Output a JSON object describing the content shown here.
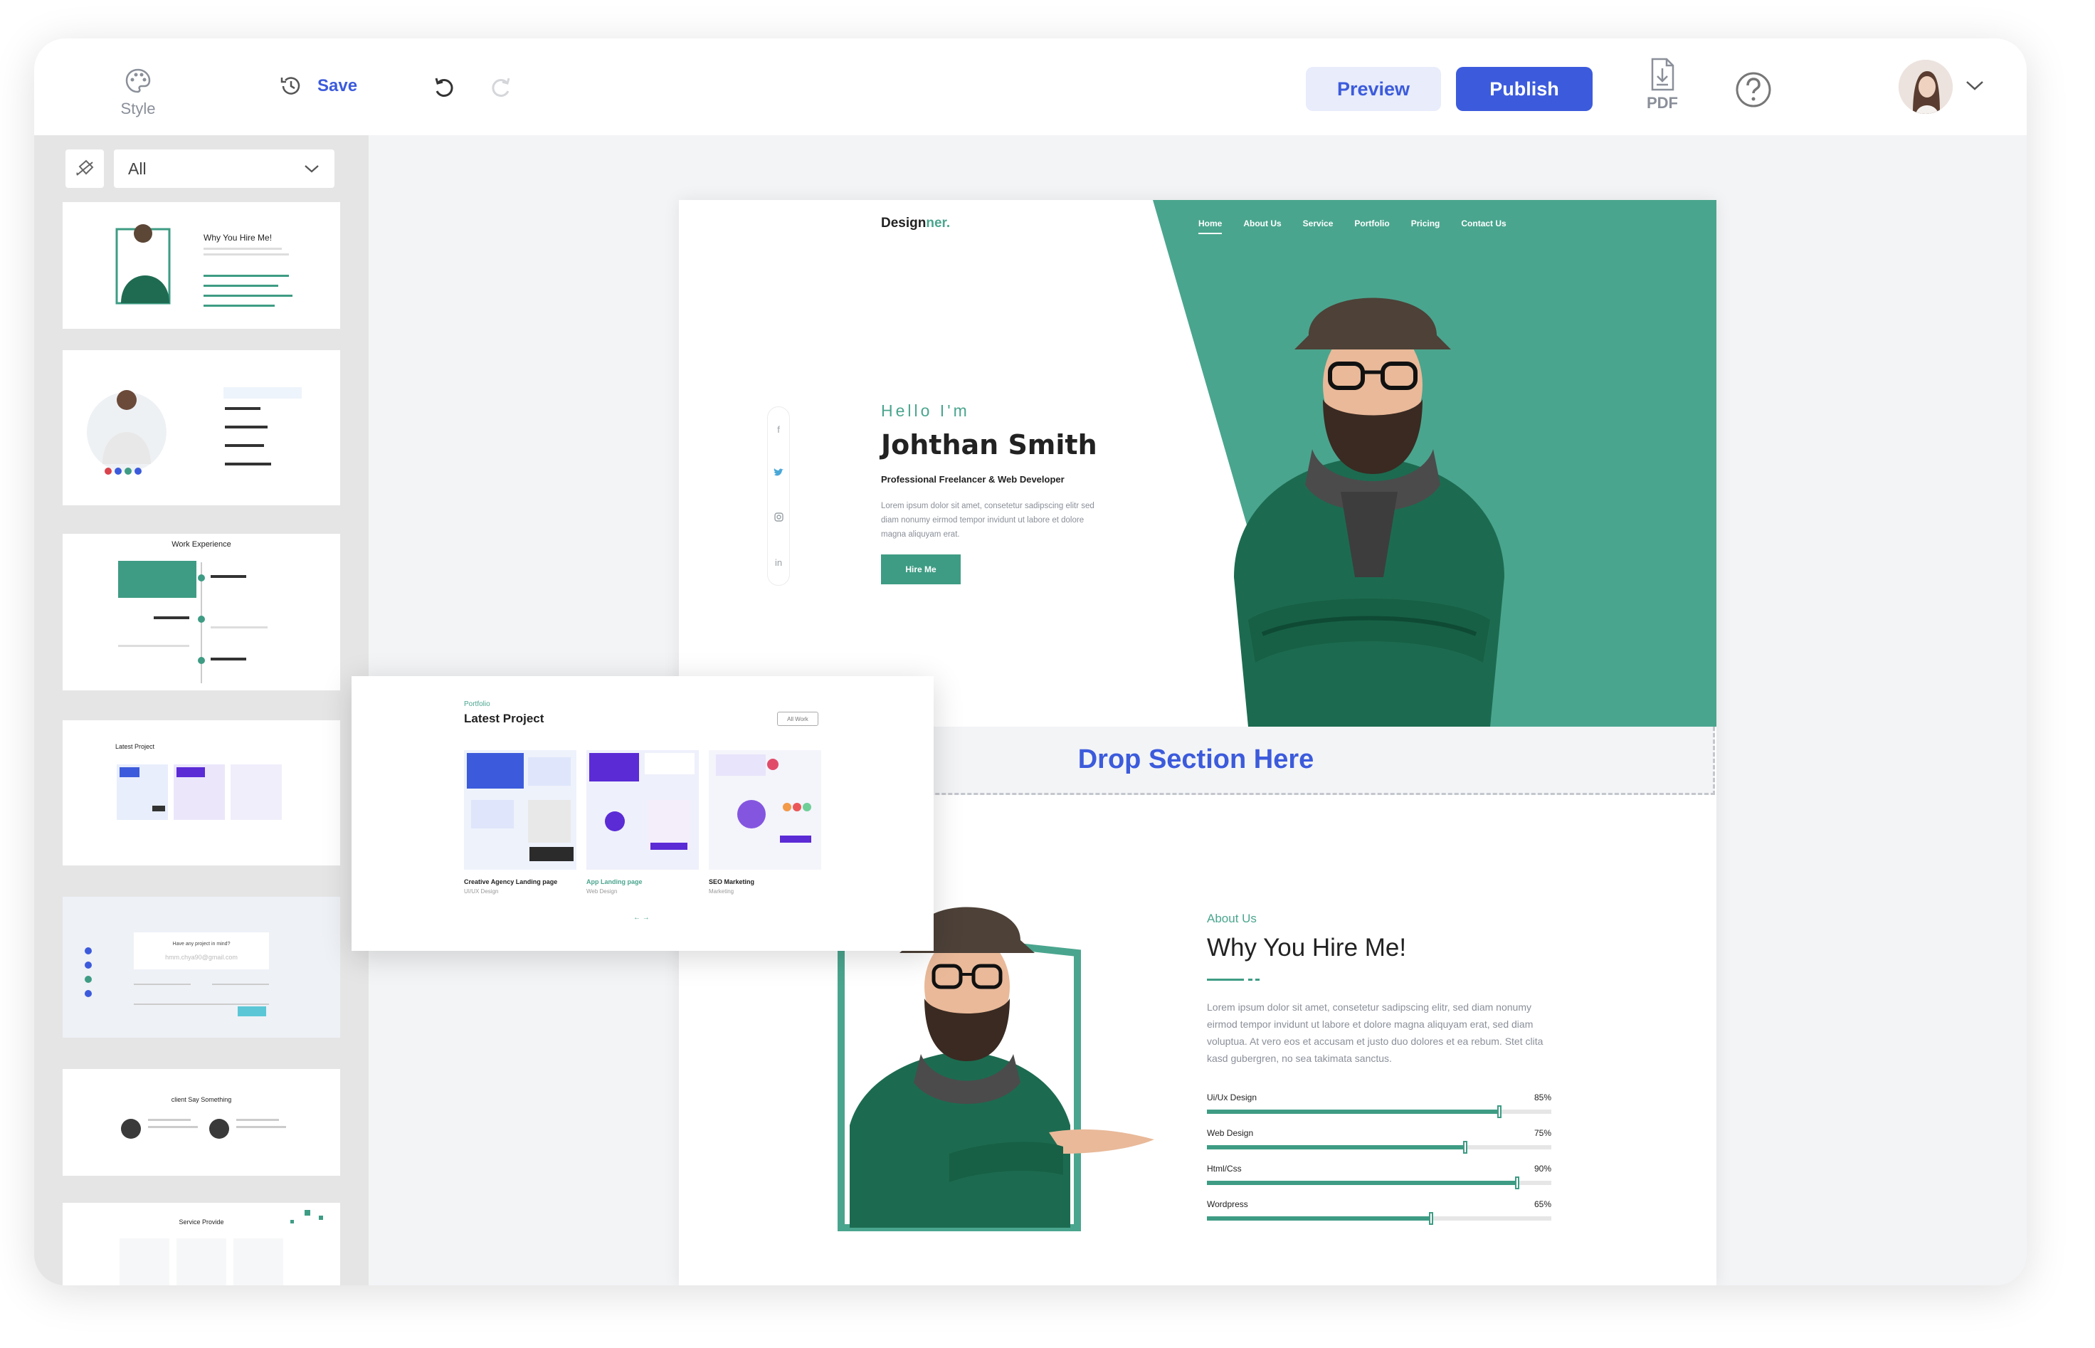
{
  "toolbar": {
    "style_label": "Style",
    "save_label": "Save",
    "preview_label": "Preview",
    "publish_label": "Publish",
    "pdf_label": "PDF"
  },
  "sidebar": {
    "filter_value": "All",
    "thumbnails": [
      {
        "name": "why-you-hire-me",
        "title": "Why You Hire Me!"
      },
      {
        "name": "services-list",
        "title": ""
      },
      {
        "name": "work-experience",
        "title": "Work Experience"
      },
      {
        "name": "latest-project",
        "title": "Latest Project"
      },
      {
        "name": "contact",
        "title": "Have any project in mind? ",
        "email": "hmm.chya90@gmail.com"
      },
      {
        "name": "client-say-something",
        "title": "client Say Something"
      },
      {
        "name": "service-provide",
        "title": "Service Provide"
      }
    ]
  },
  "hero": {
    "logo": "Design",
    "logo_accent": "ner.",
    "nav": [
      "Home",
      "About Us",
      "Service",
      "Portfolio",
      "Pricing",
      "Contact Us"
    ],
    "greeting": "Hello I'm",
    "name": "Johthan Smith",
    "role": "Professional Freelancer & Web Developer",
    "description": "Lorem ipsum dolor sit amet, consetetur sadipscing elitr sed diam nonumy eirmod tempor invidunt ut labore et dolore magna aliquyam erat.",
    "cta": "Hire Me",
    "socials": [
      "f",
      "t",
      "ig",
      "in"
    ]
  },
  "drop_zone": {
    "label": "Drop Section Here"
  },
  "about": {
    "label": "About Us",
    "title": "Why You Hire Me!",
    "description": "Lorem ipsum dolor sit amet, consetetur sadipscing elitr, sed diam nonumy eirmod tempor invidunt ut labore et dolore magna aliquyam erat, sed diam voluptua. At vero eos et accusam et justo duo dolores et ea rebum. Stet clita kasd gubergren, no sea takimata sanctus.",
    "skills": [
      {
        "name": "Ui/Ux Design",
        "percent_label": "85%",
        "value": 85
      },
      {
        "name": "Web Design",
        "percent_label": "75%",
        "value": 75
      },
      {
        "name": "Html/Css",
        "percent_label": "90%",
        "value": 90
      },
      {
        "name": "Wordpress",
        "percent_label": "65%",
        "value": 65
      }
    ]
  },
  "dragging_card": {
    "label": "Portfolio",
    "title": "Latest Project",
    "filter": "All Work",
    "projects": [
      {
        "title": "Creative Agency Landing page",
        "category": "UI/UX Design"
      },
      {
        "title": "App Landing page",
        "category": "Web Design"
      },
      {
        "title": "SEO Marketing",
        "category": "Marketing"
      }
    ]
  },
  "colors": {
    "accent_blue": "#3c5bdc",
    "brand_green": "#4aa58e",
    "dark_green": "#3e9c84"
  }
}
